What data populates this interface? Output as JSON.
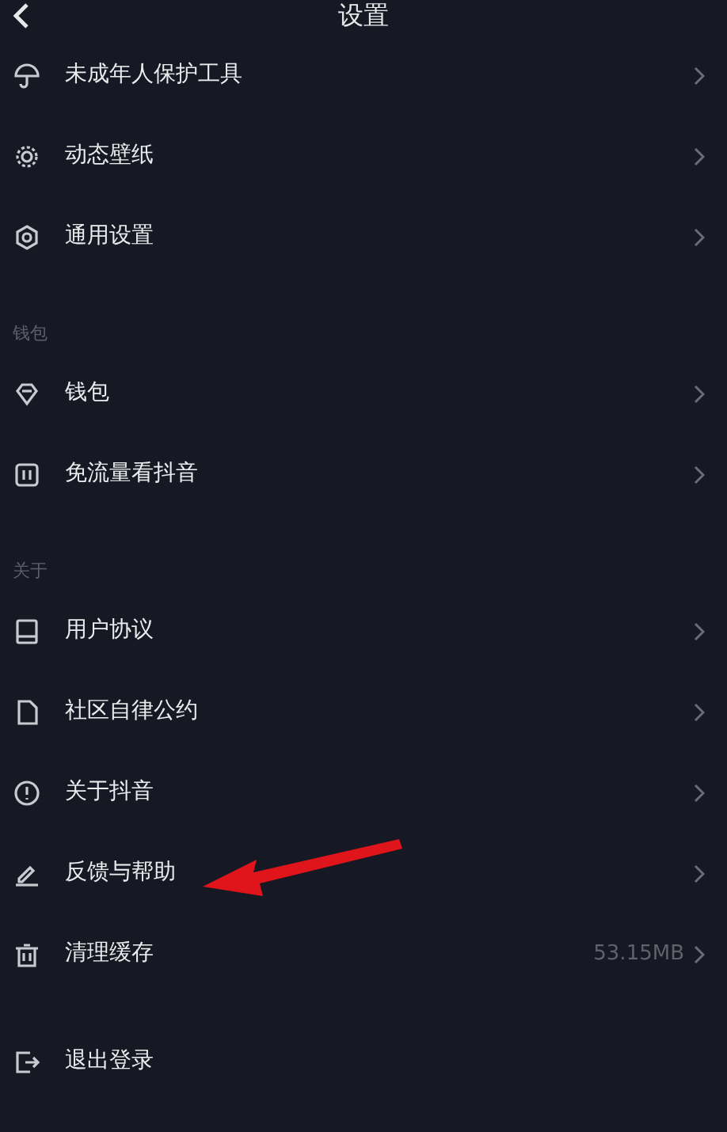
{
  "header": {
    "title": "设置"
  },
  "groups": [
    {
      "items": [
        {
          "label": "未成年人保护工具",
          "kind": "link"
        },
        {
          "label": "动态壁纸",
          "kind": "link"
        },
        {
          "label": "通用设置",
          "kind": "link"
        }
      ]
    },
    {
      "section": "钱包",
      "items": [
        {
          "label": "钱包",
          "kind": "link"
        },
        {
          "label": "免流量看抖音",
          "kind": "link"
        }
      ]
    },
    {
      "section": "关于",
      "items": [
        {
          "label": "用户协议",
          "kind": "link"
        },
        {
          "label": "社区自律公约",
          "kind": "link"
        },
        {
          "label": "关于抖音",
          "kind": "link"
        },
        {
          "label": "反馈与帮助",
          "kind": "link"
        },
        {
          "label": "清理缓存",
          "kind": "value",
          "value": "53.15MB"
        }
      ]
    },
    {
      "items": [
        {
          "label": "退出登录",
          "kind": "action"
        }
      ]
    }
  ],
  "annotation": {
    "kind": "arrow"
  }
}
